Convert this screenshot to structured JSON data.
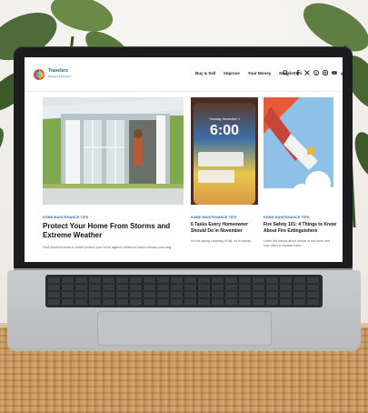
{
  "site": {
    "brand_line1": "Travelers",
    "brand_line2": "Prepare & Prevent"
  },
  "nav": {
    "items": [
      {
        "label": "Buy & Sell"
      },
      {
        "label": "Improve"
      },
      {
        "label": "Your Money"
      },
      {
        "label": "Newsletters"
      }
    ]
  },
  "articles": [
    {
      "tag": "HOME MAINTENANCE TIPS",
      "headline": "Protect Your Home From Storms and Extreme Weather",
      "excerpt": "Find practical ideas to better protect your home against whatever nature throws your way."
    },
    {
      "tag": "HOME MAINTENANCE TIPS",
      "headline": "6 Tasks Every Homeowner Should Do in November",
      "excerpt": "It's the spring cleaning of fall, so to speak."
    },
    {
      "tag": "HOME MAINTENANCE TIPS",
      "headline": "Fire Safety 101: 4 Things to Know About Fire Extinguishers",
      "excerpt": "Learn the basics about where to put them and how often to replace them."
    }
  ],
  "phone": {
    "date": "Tuesday, November 1",
    "time": "6:00"
  },
  "colors": {
    "brand": "#1e63a8",
    "accent_bar": "#3db0e6"
  }
}
